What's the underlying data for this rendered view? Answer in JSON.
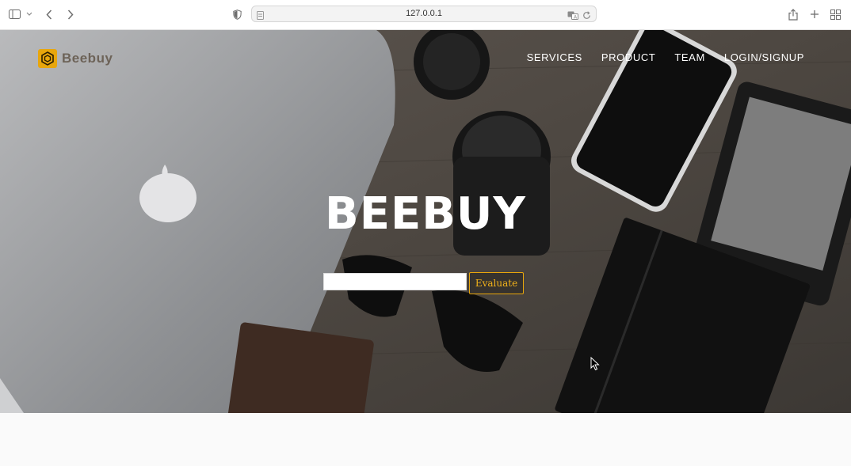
{
  "browser": {
    "url": "127.0.0.1",
    "icons": [
      "sidebar-icon",
      "chevron-down-icon",
      "back-icon",
      "forward-icon",
      "shield-icon",
      "page-icon",
      "translate-icon",
      "reload-icon",
      "share-icon",
      "new-tab-icon",
      "tab-overview-icon"
    ]
  },
  "site": {
    "logo_text": "Beebuy",
    "nav": [
      "SERVICES",
      "PRODUCT",
      "TEAM",
      "LOGIN/SIGNUP"
    ],
    "hero_title": "BEEBUY",
    "search_value": "",
    "evaluate_label": "Evaluate"
  },
  "colors": {
    "accent": "#e8a60c",
    "hero_overlay": "#4a4541"
  }
}
